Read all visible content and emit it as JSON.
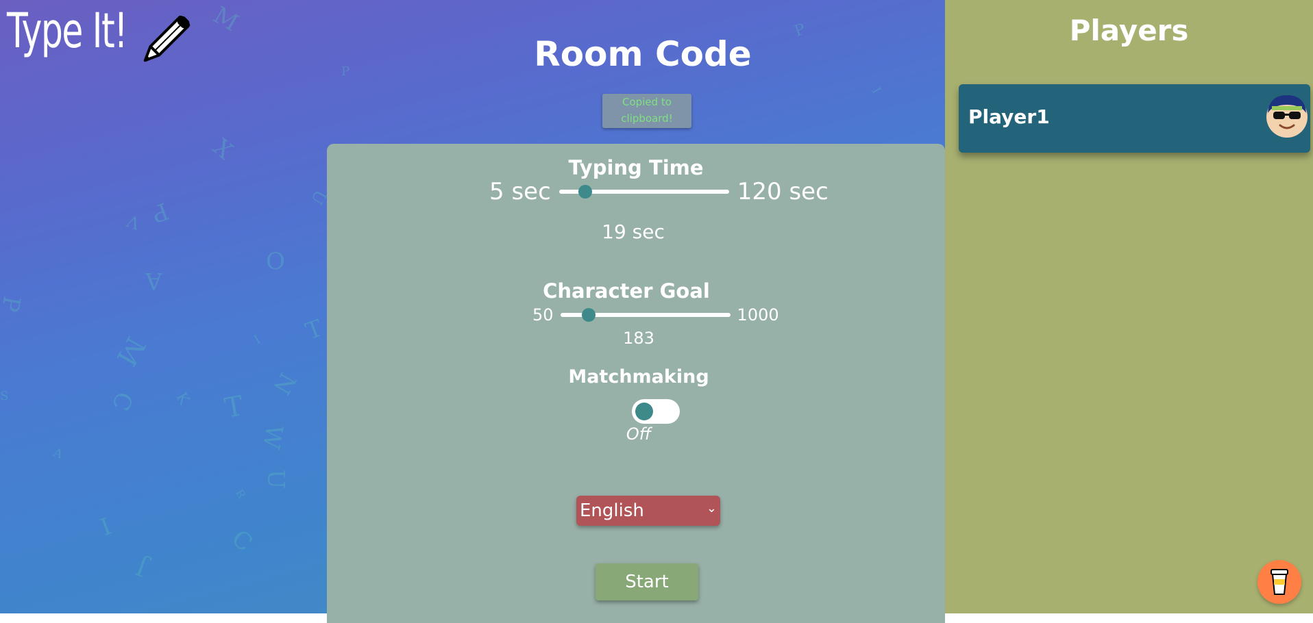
{
  "app": {
    "logo_text": "Type It!"
  },
  "header": {
    "title": "Room Code",
    "copied_message": "Copied to clipboard!"
  },
  "settings": {
    "typing_time": {
      "title": "Typing Time",
      "min_label": "5 sec",
      "max_label": "120 sec",
      "min": 5,
      "max": 120,
      "value": 19,
      "value_label": "19 sec"
    },
    "character_goal": {
      "title": "Character Goal",
      "min_label": "50",
      "max_label": "1000",
      "min": 50,
      "max": 1000,
      "value": 183,
      "value_label": "183"
    },
    "matchmaking": {
      "title": "Matchmaking",
      "state_label": "Off",
      "enabled": false
    },
    "language": {
      "selected": "English"
    },
    "start_label": "Start"
  },
  "players": {
    "title": "Players",
    "list": [
      {
        "name": "Player1",
        "avatar": "avatar-sunglasses-icon"
      }
    ]
  },
  "background_letters": [
    "M",
    "P",
    "P",
    "I",
    "X",
    "P",
    "V",
    "U",
    "O",
    "A",
    "P",
    "M",
    "I",
    "T",
    "N",
    "K",
    "C",
    "T",
    "W",
    "U",
    "R",
    "C",
    "I",
    "J",
    "S",
    "A"
  ],
  "colors": {
    "panel": "#97b0a8",
    "sidebar": "#a8b070",
    "player_card": "#24647a",
    "select": "#b05458",
    "start": "#88a878",
    "slider_thumb": "#3e8a8a",
    "coffee": "#ff7f45"
  },
  "icons": {
    "pencil": "pencil-icon",
    "coffee": "coffee-cup-icon"
  }
}
